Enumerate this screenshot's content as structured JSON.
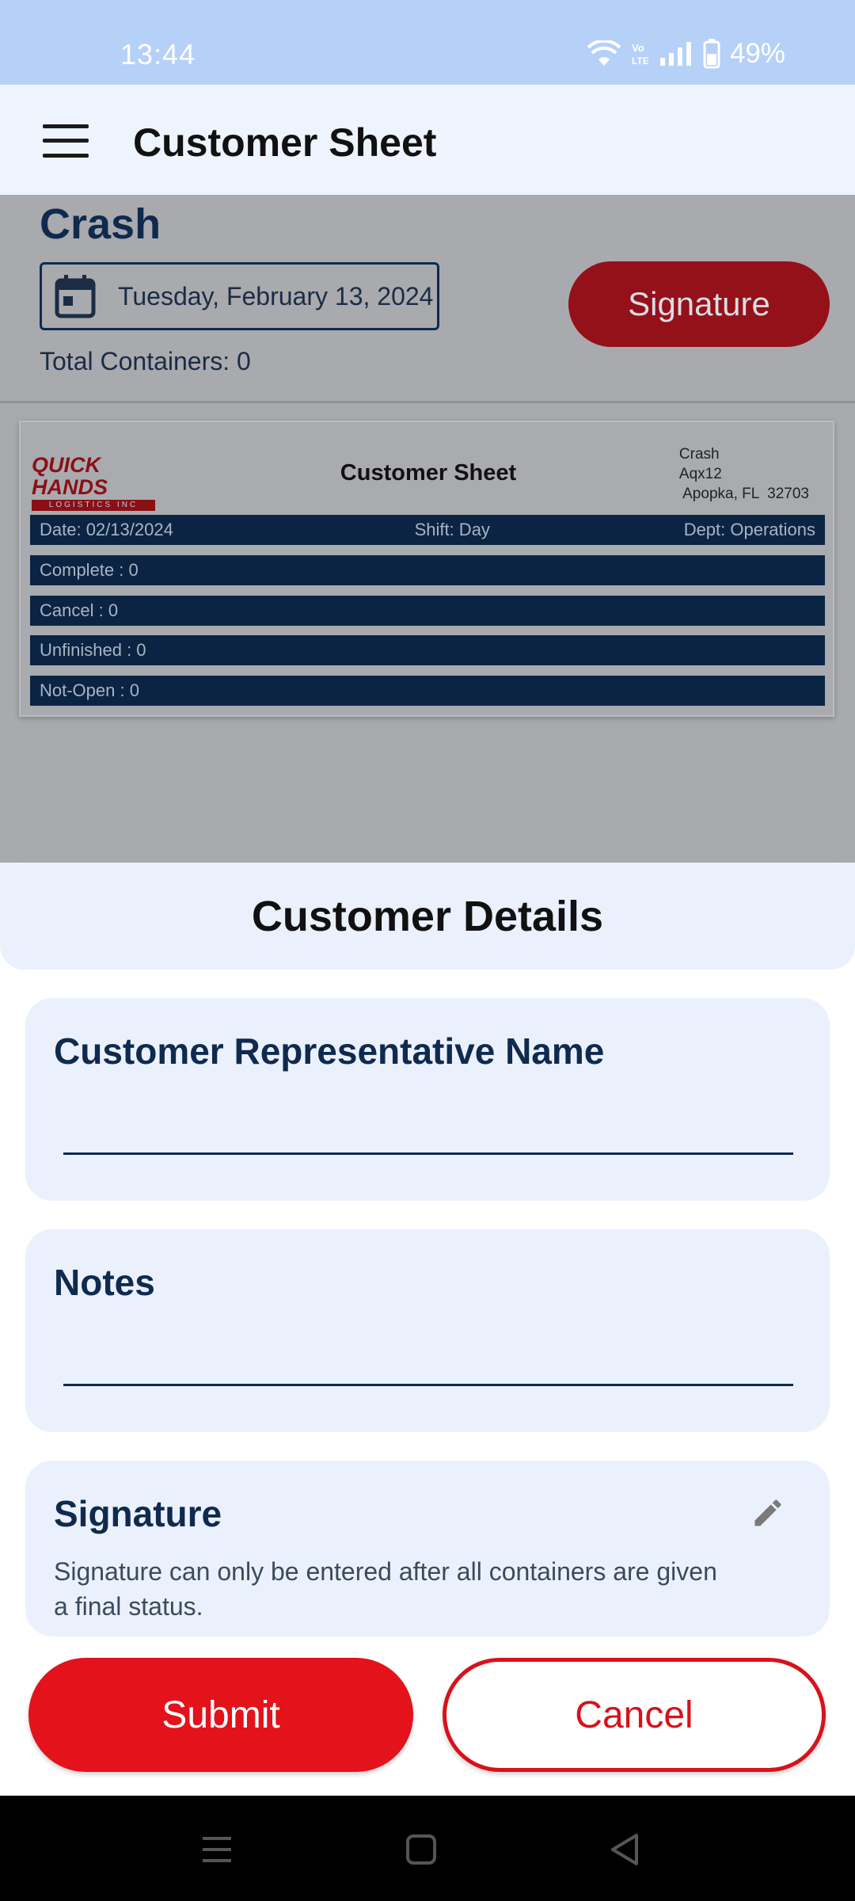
{
  "status_bar": {
    "time": "13:44",
    "battery": "49%",
    "icons": [
      "wifi-icon",
      "volte-icon",
      "signal-icon",
      "battery-icon"
    ]
  },
  "app_bar": {
    "title": "Customer Sheet",
    "menu_icon": "hamburger-menu-icon"
  },
  "page": {
    "heading": "Crash",
    "date": "Tuesday, February 13, 2024",
    "signature_button": "Signature",
    "total_containers": "Total Containers: 0",
    "sheet": {
      "logo_line1": "QUICK HANDS",
      "logo_line2": "LOGISTICS INC",
      "title": "Customer Sheet",
      "address": [
        "Crash",
        "Aqx12",
        " Apopka, FL  32703"
      ],
      "date": "Date: 02/13/2024",
      "shift": "Shift: Day",
      "dept": "Dept: Operations",
      "rows": [
        "Complete : 0",
        "Cancel : 0",
        "Unfinished : 0",
        "Not-Open : 0"
      ]
    }
  },
  "modal": {
    "title": "Customer Details",
    "rep_name_label": "Customer Representative Name",
    "rep_name_value": "",
    "notes_label": "Notes",
    "notes_value": "",
    "signature_label": "Signature",
    "signature_desc": "Signature can only be entered after all containers are given a final status.",
    "submit": "Submit",
    "cancel": "Cancel"
  },
  "colors": {
    "primary_red": "#e3121b",
    "navy": "#0f2a4e",
    "card_bg": "#eaf1fc"
  }
}
